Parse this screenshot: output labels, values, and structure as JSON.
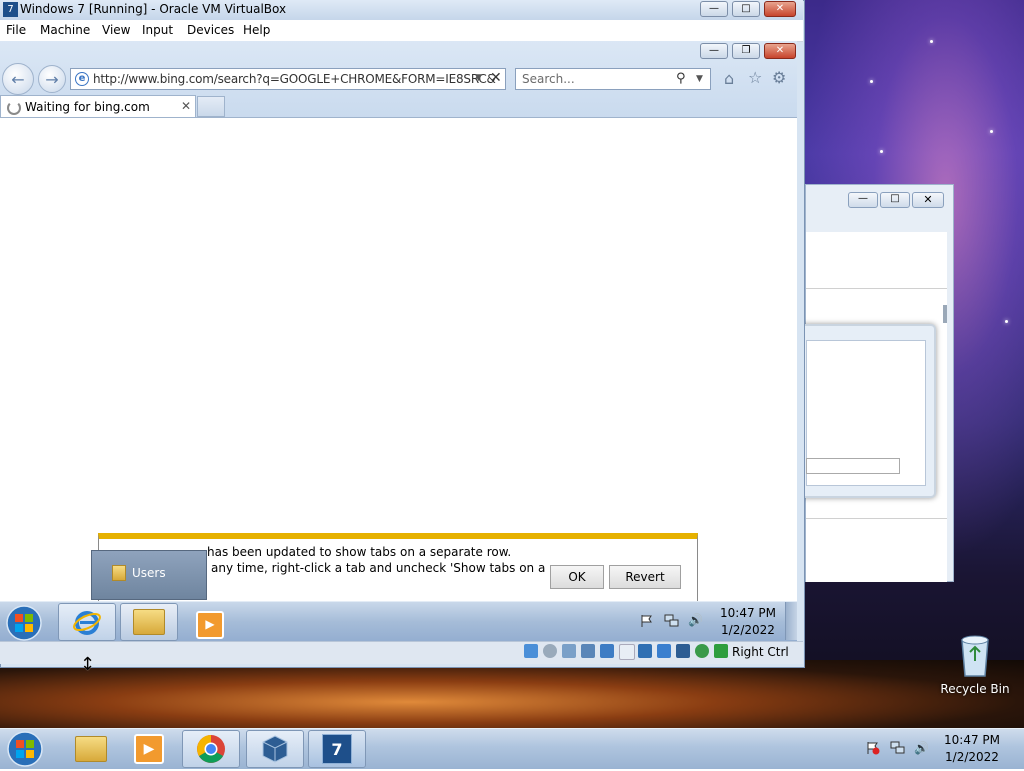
{
  "host": {
    "recycle_bin_label": "Recycle Bin",
    "clock": {
      "time": "10:47 PM",
      "date": "1/2/2022"
    }
  },
  "vbox": {
    "title": "Windows 7 [Running] - Oracle VM VirtualBox",
    "menu": [
      "File",
      "Machine",
      "View",
      "Input",
      "Devices",
      "Help"
    ],
    "host_key": "Right Ctrl"
  },
  "ie": {
    "address": "http://www.bing.com/search?q=GOOGLE+CHROME&FORM=IE8SRC&",
    "search_placeholder": "Search...",
    "tab_label": "Waiting for bing.com"
  },
  "notification": {
    "line1": "has been updated to show tabs on a separate row.",
    "line2": "any time, right-click a tab and uncheck 'Show tabs on a",
    "ok_label": "OK",
    "revert_label": "Revert"
  },
  "jumplist": {
    "item": "Users"
  },
  "guest_clock": {
    "time": "10:47 PM",
    "date": "1/2/2022"
  },
  "colors": {
    "accent_notif": "#e6b100",
    "taskbar": "#a5bcd8"
  }
}
